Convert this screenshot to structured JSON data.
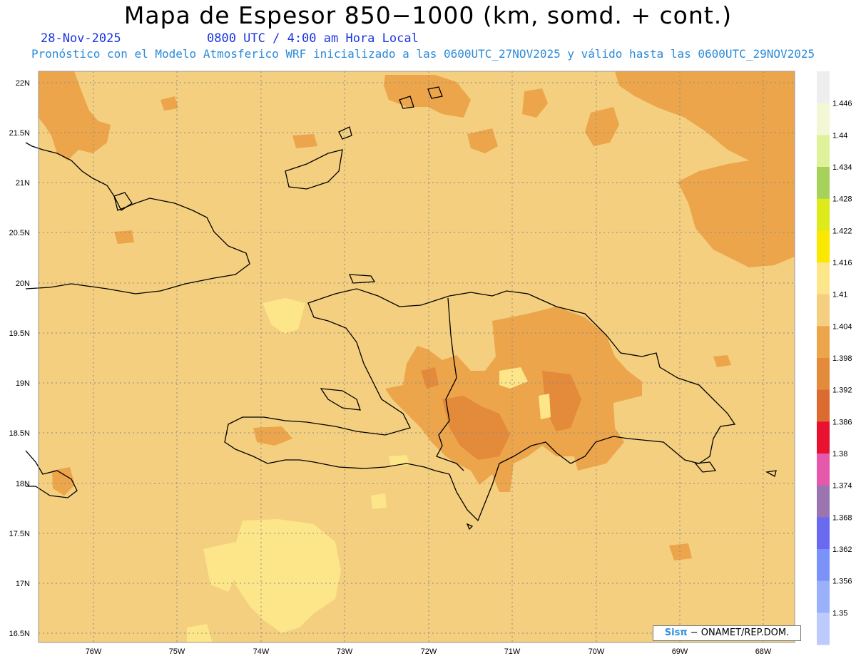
{
  "title": "Mapa de Espesor 850−1000 (km, somd. + cont.)",
  "date": "28-Nov-2025",
  "time_label": "0800 UTC / 4:00 am Hora Local",
  "description": "Pronóstico con el Modelo Atmosferico WRF inicializado a las 0600UTC_27NOV2025 y válido hasta las  0600UTC_29NOV2025",
  "credit": {
    "brand": "Sisπ",
    "org": " − ONAMET/REP.DOM."
  },
  "lat_labels": [
    "22N",
    "21.5N",
    "21N",
    "20.5N",
    "20N",
    "19.5N",
    "19N",
    "18.5N",
    "18N",
    "17.5N",
    "17N",
    "16.5N"
  ],
  "lon_labels": [
    "76W",
    "75W",
    "74W",
    "73W",
    "72W",
    "71W",
    "70W",
    "69W",
    "68W"
  ],
  "legend": {
    "labels": [
      "1.446",
      "1.44",
      "1.434",
      "1.428",
      "1.422",
      "1.416",
      "1.41",
      "1.404",
      "1.398",
      "1.392",
      "1.386",
      "1.38",
      "1.374",
      "1.368",
      "1.362",
      "1.356",
      "1.35"
    ],
    "colors": [
      "#eeeeee",
      "#f3f7d6",
      "#dff29a",
      "#a6d15a",
      "#ddeb1a",
      "#fae800",
      "#fde58a",
      "#f3cf7f",
      "#eca54b",
      "#e38a3b",
      "#db6b30",
      "#e8112f",
      "#e658ab",
      "#9a75b0",
      "#6a6af0",
      "#7b93f8",
      "#9ab0fb",
      "#bccafc"
    ]
  },
  "colors": {
    "base": "#f3cf7f",
    "warm": "#eca54b",
    "hot": "#e38a3b",
    "cool": "#fde58a"
  }
}
